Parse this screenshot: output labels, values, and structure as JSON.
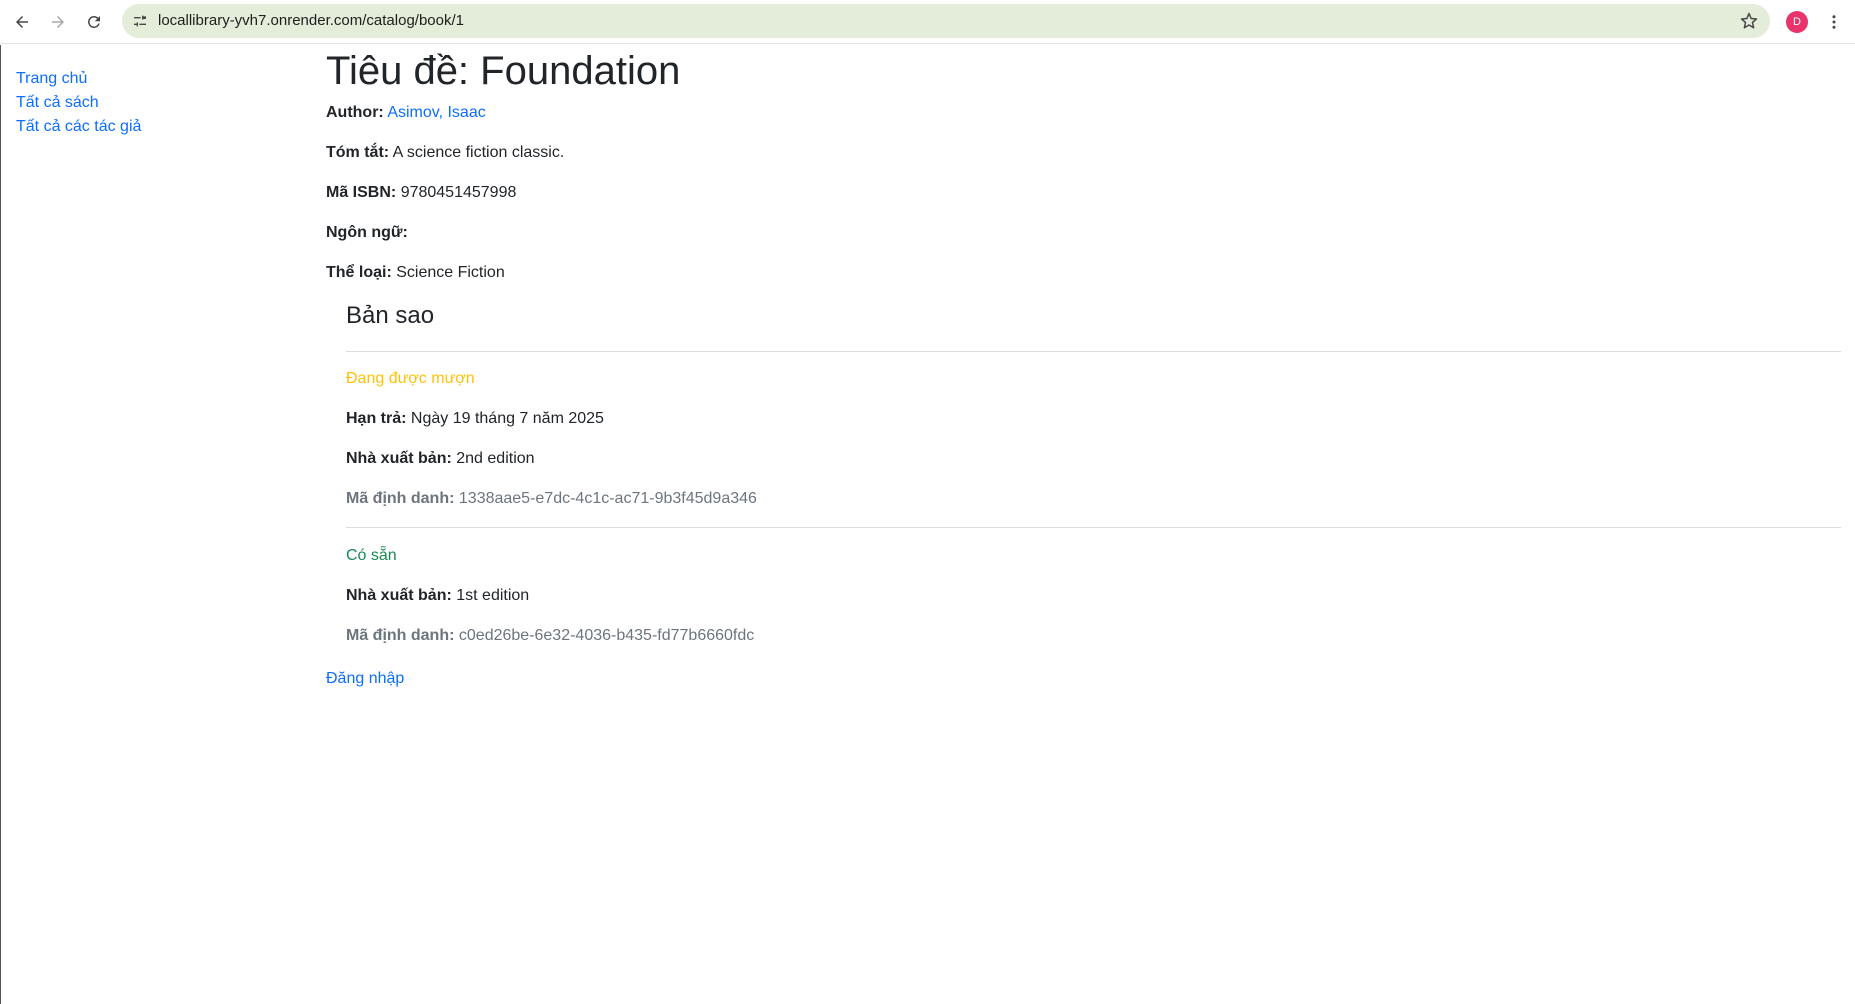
{
  "browser": {
    "url": "locallibrary-yvh7.onrender.com/catalog/book/1",
    "profile_initial": "D",
    "icons": {
      "back": "arrow-left-icon",
      "forward": "arrow-right-icon",
      "reload": "reload-icon",
      "site_info": "tune-icon",
      "bookmark": "star-icon",
      "menu": "kebab-menu-icon"
    }
  },
  "sidebar": {
    "items": [
      {
        "label": "Trang chủ"
      },
      {
        "label": "Tất cả sách"
      },
      {
        "label": "Tất cả các tác giả"
      }
    ]
  },
  "book": {
    "title": "Tiêu đề: Foundation",
    "author_label": "Author:",
    "author": "Asimov, Isaac",
    "summary_label": "Tóm tắt:",
    "summary": "A science fiction classic.",
    "isbn_label": "Mã ISBN:",
    "isbn": "9780451457998",
    "language_label": "Ngôn ngữ:",
    "language": "",
    "genre_label": "Thể loại:",
    "genre": "Science Fiction"
  },
  "copies": {
    "heading": "Bản sao",
    "items": [
      {
        "status": "Đang được mượn",
        "due_label": "Hạn trả:",
        "due": "Ngày 19 tháng 7 năm 2025",
        "imprint_label": "Nhà xuất bản:",
        "imprint": "2nd edition",
        "id_label": "Mã định danh:",
        "id": "1338aae5-e7dc-4c1c-ac71-9b3f45d9a346"
      },
      {
        "status": "Có sẵn",
        "imprint_label": "Nhà xuất bản:",
        "imprint": "1st edition",
        "id_label": "Mã định danh:",
        "id": "c0ed26be-6e32-4036-b435-fd77b6660fdc"
      }
    ]
  },
  "login_label": "Đăng nhập",
  "colors": {
    "link": "#0d6efd",
    "status_maintenance": "#ffc107",
    "status_available": "#198754",
    "muted": "#6c757d",
    "omnibox": "#e4ecda",
    "avatar": "#e8336b"
  }
}
